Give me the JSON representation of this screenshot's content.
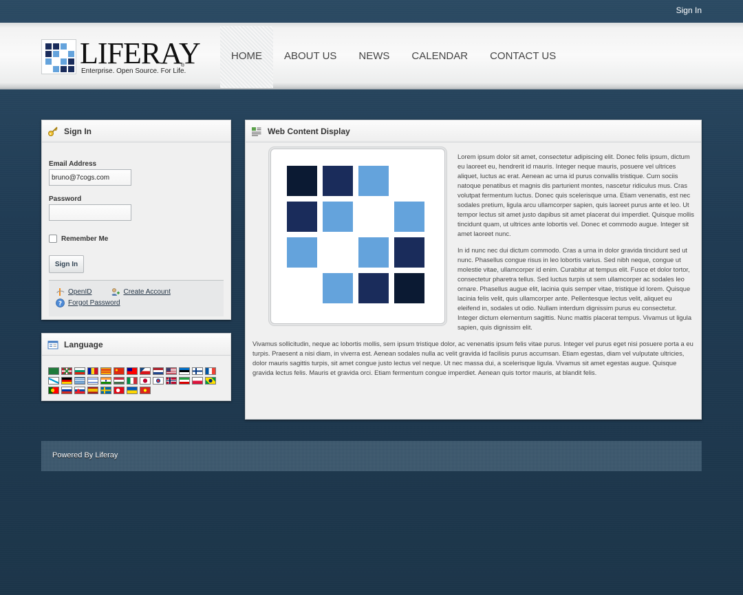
{
  "topbar": {
    "sign_in": "Sign In"
  },
  "logo": {
    "name": "LIFERAY",
    "registered": "®",
    "tagline": "Enterprise. Open Source. For Life."
  },
  "nav": {
    "items": [
      "HOME",
      "ABOUT US",
      "NEWS",
      "CALENDAR",
      "CONTACT US"
    ],
    "active": "HOME"
  },
  "signin_portlet": {
    "title": "Sign In",
    "email_label": "Email Address",
    "email_value": "bruno@7cogs.com",
    "password_label": "Password",
    "password_value": "",
    "remember_label": "Remember Me",
    "button_label": "Sign In",
    "openid_label": "OpenID",
    "create_account_label": "Create Account",
    "forgot_password_label": "Forgot Password"
  },
  "language_portlet": {
    "title": "Language",
    "flags": [
      "arabic",
      "basque",
      "bulgarian",
      "catalan",
      "catalonia",
      "chinese-simplified",
      "chinese-traditional",
      "czech",
      "dutch",
      "english-us",
      "estonian",
      "finnish",
      "french",
      "galician",
      "german",
      "greek",
      "hebrew",
      "hindi",
      "hungarian",
      "italian",
      "japanese",
      "korean",
      "norwegian",
      "persian",
      "polish",
      "portuguese-brazil",
      "portuguese",
      "russian",
      "slovak",
      "spanish",
      "swedish",
      "turkish",
      "ukrainian",
      "vietnamese"
    ]
  },
  "web_content": {
    "title": "Web Content Display",
    "paragraphs": [
      "Lorem ipsum dolor sit amet, consectetur adipiscing elit. Donec felis ipsum, dictum eu laoreet eu, hendrerit id mauris. Integer neque mauris, posuere vel ultrices aliquet, luctus ac erat. Aenean ac urna id purus convallis tristique. Cum sociis natoque penatibus et magnis dis parturient montes, nascetur ridiculus mus. Cras volutpat fermentum luctus. Donec quis scelerisque urna. Etiam venenatis, est nec sodales pretium, ligula arcu ullamcorper sapien, quis laoreet purus ante et leo. Ut tempor lectus sit amet justo dapibus sit amet placerat dui imperdiet. Quisque mollis tincidunt quam, ut ultrices ante lobortis vel. Donec et commodo augue. Integer sit amet laoreet nunc.",
      "In id nunc nec dui dictum commodo. Cras a urna in dolor gravida tincidunt sed ut nunc. Phasellus congue risus in leo lobortis varius. Sed nibh neque, congue ut molestie vitae, ullamcorper id enim. Curabitur at tempus elit. Fusce et dolor tortor, consectetur pharetra tellus. Sed luctus turpis ut sem ullamcorper ac sodales leo ornare. Phasellus augue elit, lacinia quis semper vitae, tristique id lorem. Quisque lacinia felis velit, quis ullamcorper ante. Pellentesque lectus velit, aliquet eu eleifend in, sodales ut odio. Nullam interdum dignissim purus eu consectetur. Integer dictum elementum sagittis. Nunc mattis placerat tempus. Vivamus ut ligula sapien, quis dignissim elit.",
      "Vivamus sollicitudin, neque ac lobortis mollis, sem ipsum tristique dolor, ac venenatis ipsum felis vitae purus. Integer vel purus eget nisi posuere porta a eu turpis. Praesent a nisi diam, in viverra est. Aenean sodales nulla ac velit gravida id facilisis purus accumsan. Etiam egestas, diam vel vulputate ultricies, dolor mauris sagittis turpis, sit amet congue justo lectus vel neque. Ut nec massa dui, a scelerisque ligula. Vivamus sit amet egestas augue. Quisque gravida lectus felis. Mauris et gravida orci. Etiam fermentum congue imperdiet. Aenean quis tortor mauris, at blandit felis."
    ]
  },
  "footer": {
    "text": "Powered By Liferay"
  },
  "colors": {
    "dark_navy": "#0b1a33",
    "navy": "#1a2c5b",
    "light_blue": "#64a3dc",
    "background": "#213a4f"
  }
}
